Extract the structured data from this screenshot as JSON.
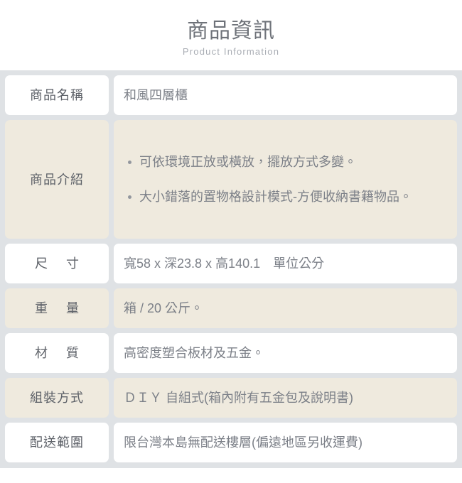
{
  "header": {
    "title": "商品資訊",
    "subtitle": "Product Information"
  },
  "colors": {
    "page_background": "#ffffff",
    "table_grid": "#dfe2e5",
    "cell_white": "#ffffff",
    "cell_beige": "#efeade",
    "label_text": "#5d6168",
    "value_text": "#7c8088",
    "title_text": "#6e7279",
    "subtitle_text": "#a9adb4",
    "bullet_dot": "#93979e"
  },
  "table": {
    "rows": [
      {
        "label": "商品名稱",
        "value": "和風四層櫃",
        "tint": "white",
        "label_style": "tight"
      },
      {
        "label": "商品介紹",
        "tint": "beige",
        "label_style": "tight",
        "bullets": [
          "可依環境正放或橫放，擺放方式多變。",
          "大小錯落的置物格設計模式-方便收納書籍物品。"
        ]
      },
      {
        "label": "尺寸",
        "value": "寬58 x 深23.8 x 高140.1　單位公分",
        "tint": "white",
        "label_style": "spaced"
      },
      {
        "label": "重量",
        "value": "箱 / 20 公斤。",
        "tint": "beige",
        "label_style": "spaced"
      },
      {
        "label": "材質",
        "value": "高密度塑合板材及五金。",
        "tint": "white",
        "label_style": "spaced"
      },
      {
        "label": "組裝方式",
        "value": "ＤＩＹ 自組式(箱內附有五金包及說明書)",
        "tint": "beige",
        "label_style": "tight"
      },
      {
        "label": "配送範圍",
        "value": "限台灣本島無配送樓層(偏遠地區另收運費)",
        "tint": "white",
        "label_style": "tight"
      }
    ]
  }
}
